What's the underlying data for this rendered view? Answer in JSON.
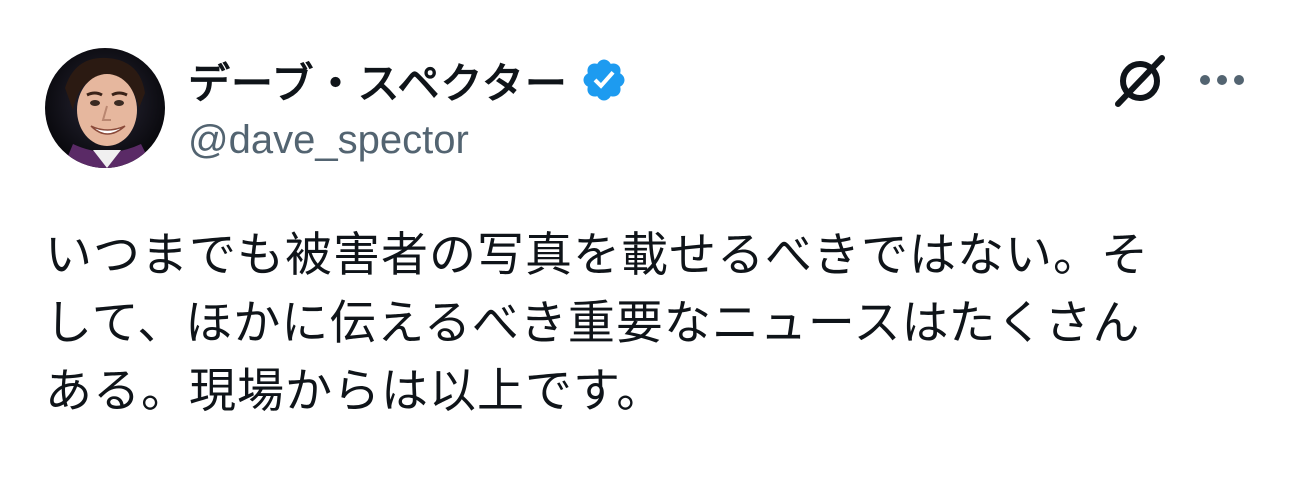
{
  "author": {
    "display_name": "デーブ・スペクター",
    "handle": "@dave_spector",
    "verified_color": "#1d9bf0"
  },
  "icons": {
    "verified": "verified-badge-icon",
    "grok": "grok-icon",
    "more": "more-horizontal-icon"
  },
  "tweet": {
    "lines": [
      "いつまでも被害者の写真を載せるべきではない。そ",
      "して、ほかに伝えるべき重要なニュースはたくさん",
      "ある。現場からは以上です。"
    ]
  },
  "colors": {
    "text": "#0f1419",
    "secondary": "#536471",
    "accent": "#1d9bf0"
  }
}
